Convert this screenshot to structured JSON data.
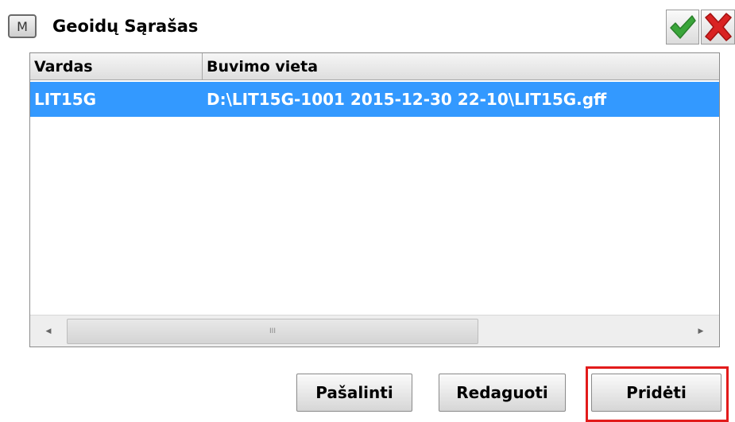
{
  "window": {
    "menu_label": "M",
    "title": "Geoidų Sąrašas",
    "ok_icon": "checkmark-icon",
    "cancel_icon": "close-icon",
    "colors": {
      "ok": "#3aa53a",
      "cancel": "#d92323"
    }
  },
  "list": {
    "columns": [
      "Vardas",
      "Buvimo vieta"
    ],
    "rows": [
      {
        "name": "LIT15G",
        "location": "D:\\LIT15G-1001 2015-12-30 22-10\\LIT15G.gff",
        "selected": true
      }
    ],
    "selection_color": "#3399ff",
    "scroll": {
      "left_arrow": "◀",
      "right_arrow": "▶",
      "thumb_grip": "III"
    }
  },
  "buttons": {
    "remove": "Pašalinti",
    "edit": "Redaguoti",
    "add": "Pridėti"
  },
  "highlight_color": "#e21b1b"
}
